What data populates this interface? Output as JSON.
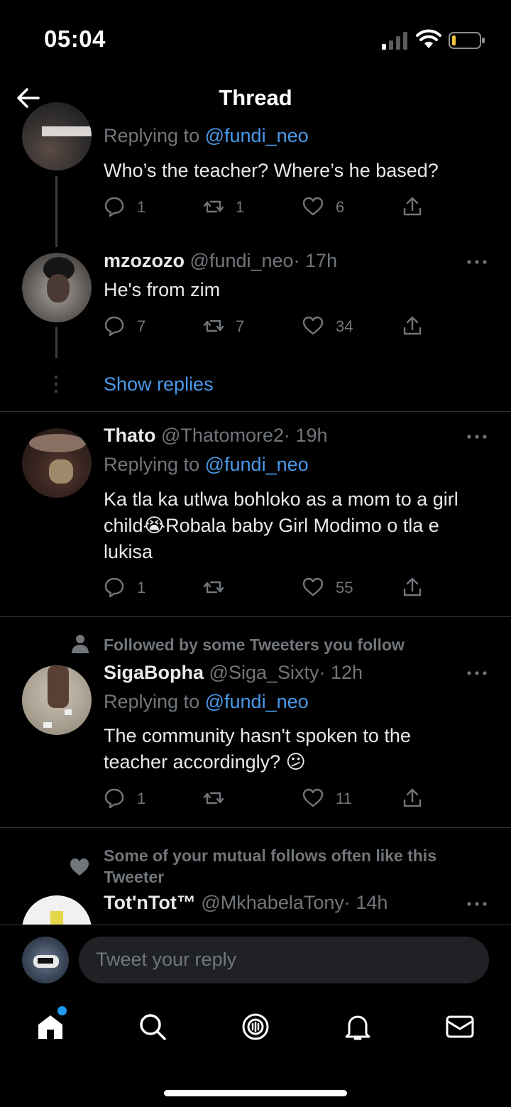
{
  "status_bar": {
    "time": "05:04"
  },
  "header": {
    "title": "Thread"
  },
  "tweets": [
    {
      "replying_prefix": "Replying to",
      "replying_to": "@fundi_neo",
      "text": "Who’s the teacher? Where’s he based?",
      "replies": "1",
      "retweets": "1",
      "likes": "6"
    },
    {
      "name": "mzozozo",
      "handle": "@fundi_neo",
      "time": "· 17h",
      "text": "He's from zim",
      "replies": "7",
      "retweets": "7",
      "likes": "34"
    },
    {
      "name": "Thato",
      "handle": "@Thatomore2",
      "time": "· 19h",
      "replying_prefix": "Replying to",
      "replying_to": "@fundi_neo",
      "text": "Ka tla ka utlwa bohloko as a mom to a girl child😭Robala baby Girl Modimo o tla e lukisa",
      "replies": "1",
      "retweets": "",
      "likes": "55"
    },
    {
      "social_context": "Followed by some Tweeters you follow",
      "name": "SigaBopha",
      "handle": "@Siga_Sixty",
      "time": "· 12h",
      "replying_prefix": "Replying to",
      "replying_to": "@fundi_neo",
      "text": "The community hasn't spoken to the teacher accordingly? 😕",
      "replies": "1",
      "retweets": "",
      "likes": "11"
    },
    {
      "social_context": "Some of your mutual follows often like this Tweeter",
      "name": "Tot'nTot™",
      "handle": "@MkhabelaTony",
      "time": "· 14h"
    }
  ],
  "show_replies": "Show replies",
  "reply_bar": {
    "placeholder": "Tweet your reply"
  },
  "tab_bar": {
    "items": [
      "home-icon",
      "search-icon",
      "spaces-icon",
      "notifications-icon",
      "messages-icon"
    ],
    "home_has_dot": true
  },
  "colors": {
    "accent": "#4a99e9",
    "muted": "#71767b",
    "background": "#000000"
  }
}
